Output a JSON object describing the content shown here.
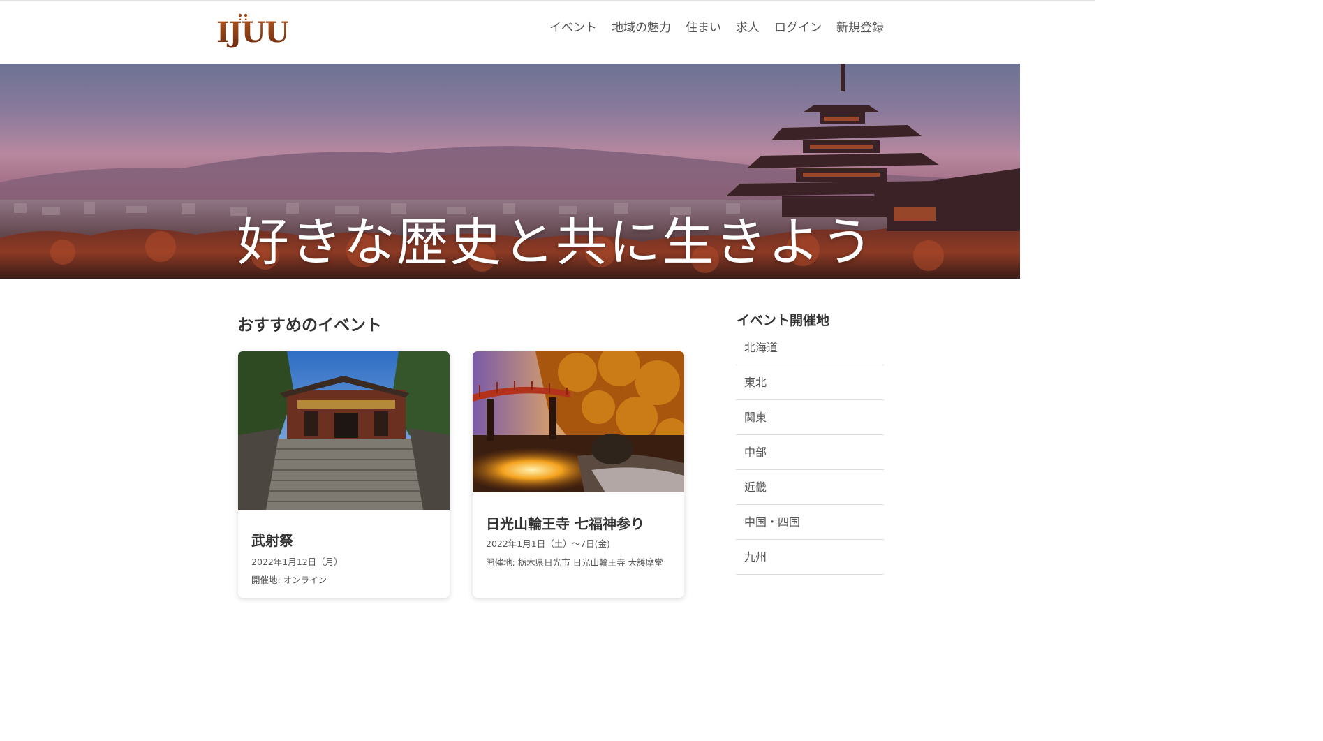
{
  "brand": {
    "logo_text": "IJUU"
  },
  "nav": {
    "items": [
      {
        "label": "イベント"
      },
      {
        "label": "地域の魅力"
      },
      {
        "label": "住まい"
      },
      {
        "label": "求人"
      },
      {
        "label": "ログイン"
      },
      {
        "label": "新規登録"
      }
    ]
  },
  "hero": {
    "title": "好きな歴史と共に生きよう"
  },
  "main": {
    "section_title": "おすすめのイベント",
    "events": [
      {
        "title": "武射祭",
        "date": "2022年1月12日（月）",
        "venue": "開催地: オンライン"
      },
      {
        "title": "日光山輪王寺 七福神参り",
        "date": "2022年1月1日（土）～7日(金)",
        "venue": "開催地: 栃木県日光市 日光山輪王寺 大護摩堂"
      }
    ]
  },
  "sidebar": {
    "title": "イベント開催地",
    "regions": [
      {
        "label": "北海道"
      },
      {
        "label": "東北"
      },
      {
        "label": "関東"
      },
      {
        "label": "中部"
      },
      {
        "label": "近畿"
      },
      {
        "label": "中国・四国"
      },
      {
        "label": "九州"
      }
    ]
  }
}
